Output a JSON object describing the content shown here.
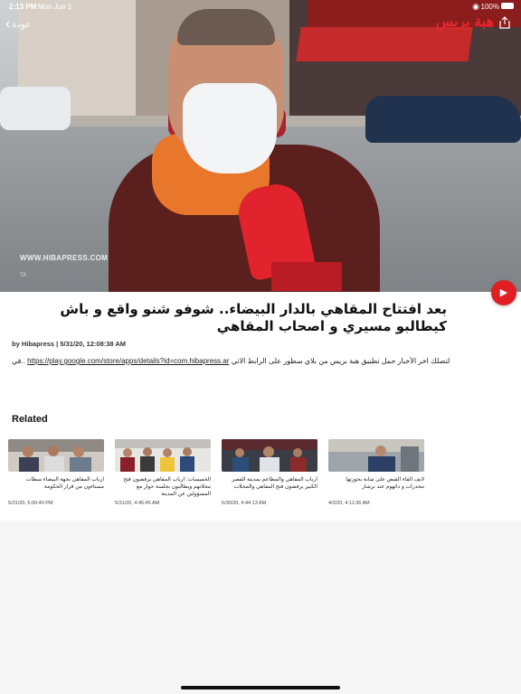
{
  "status_bar": {
    "time": "2:13 PM",
    "date": "Mon Jun 1",
    "battery": "100%"
  },
  "nav": {
    "back_label": "عودة"
  },
  "video": {
    "watermark": "WWW.HIBAPRESS.COM",
    "watermark_small": "TA",
    "brand": "هبة بريس"
  },
  "article": {
    "title": "بعد افتتاح المقاهي بالدار البيضاء.. شوفو شنو واقع و باش كيطالبو مسيري و اصحاب المقاهي",
    "byline": "by Hibapress | 5/31/20, 12:08:38 AM",
    "desc_prefix": "في",
    "desc_link": "https://play.google.com/store/apps/details?id=com.hibapress.ar",
    "desc_suffix": "لتصلك اخر الأخبار حمل تطبيق هبة بريس من بلاي سطور على الرابط الاتي"
  },
  "related": {
    "heading": "Related",
    "items": [
      {
        "title": "ارباب المقاهي بجهة البيضاء سطات مستاءون من قرار الحكومة",
        "date": "5/31/20, 5:00:40 PM"
      },
      {
        "title": "الخميسات: ارباب المقاهي يرفضون فتح محلاتهم ويطالبون بجلسة حوار مع المسؤولين عن المدينة",
        "date": "5/31/20, 4:45:45 AM"
      },
      {
        "title": "ارباب المقاهي والمطاعم بمدينة القصر الكبير يرفضون فتح المقاهي والمحلات",
        "date": "5/30/20, 4:44:13 AM"
      },
      {
        "title": "لايف القاء القبض على شابة بحوزتها مخدرات و داتهوم عند برشار",
        "date": "4/2/20, 4:11:36 AM"
      }
    ]
  },
  "colors": {
    "accent": "#e21e22",
    "background": "#ffffff"
  },
  "icons": {
    "play": "play-icon",
    "share": "share-icon",
    "back": "chevron-left-icon",
    "wifi": "wifi-icon",
    "battery": "battery-icon"
  }
}
